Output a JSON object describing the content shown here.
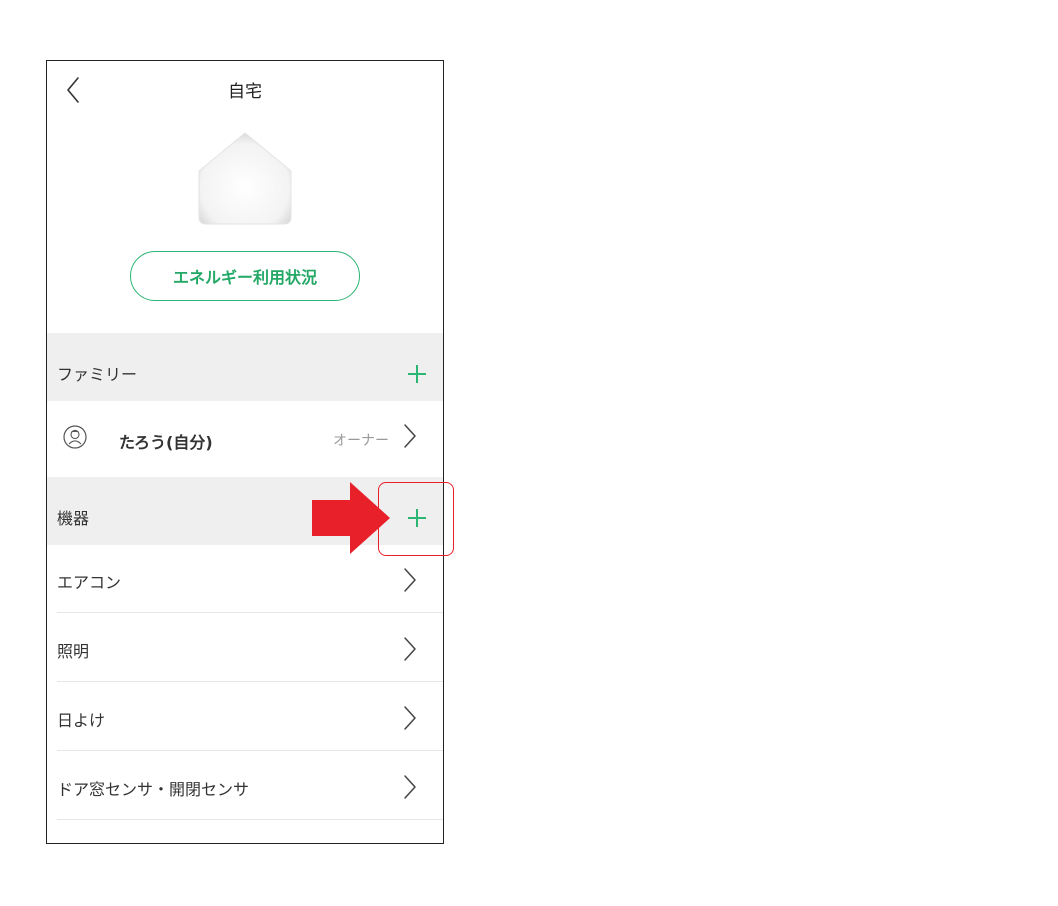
{
  "nav": {
    "title": "自宅",
    "back_icon": "chevron-left-icon"
  },
  "home_icon": "house-icon",
  "energy_button": {
    "label": "エネルギー利用状況"
  },
  "family_section": {
    "title": "ファミリー",
    "add_icon": "plus-icon",
    "members": [
      {
        "name": "たろう(自分)",
        "role": "オーナー",
        "avatar_icon": "user-avatar-icon"
      }
    ]
  },
  "devices_section": {
    "title": "機器",
    "add_icon": "plus-icon",
    "items": [
      {
        "label": "エアコン"
      },
      {
        "label": "照明"
      },
      {
        "label": "日よけ"
      },
      {
        "label": "ドア窓センサ・開閉センサ"
      }
    ]
  },
  "annotation": {
    "arrow_icon": "red-arrow-icon",
    "highlight": "red-rounded-box"
  },
  "colors": {
    "accent_green": "#2bb673",
    "section_bg": "#efefef",
    "annotation_red": "#e8202a",
    "border": "#222222"
  }
}
